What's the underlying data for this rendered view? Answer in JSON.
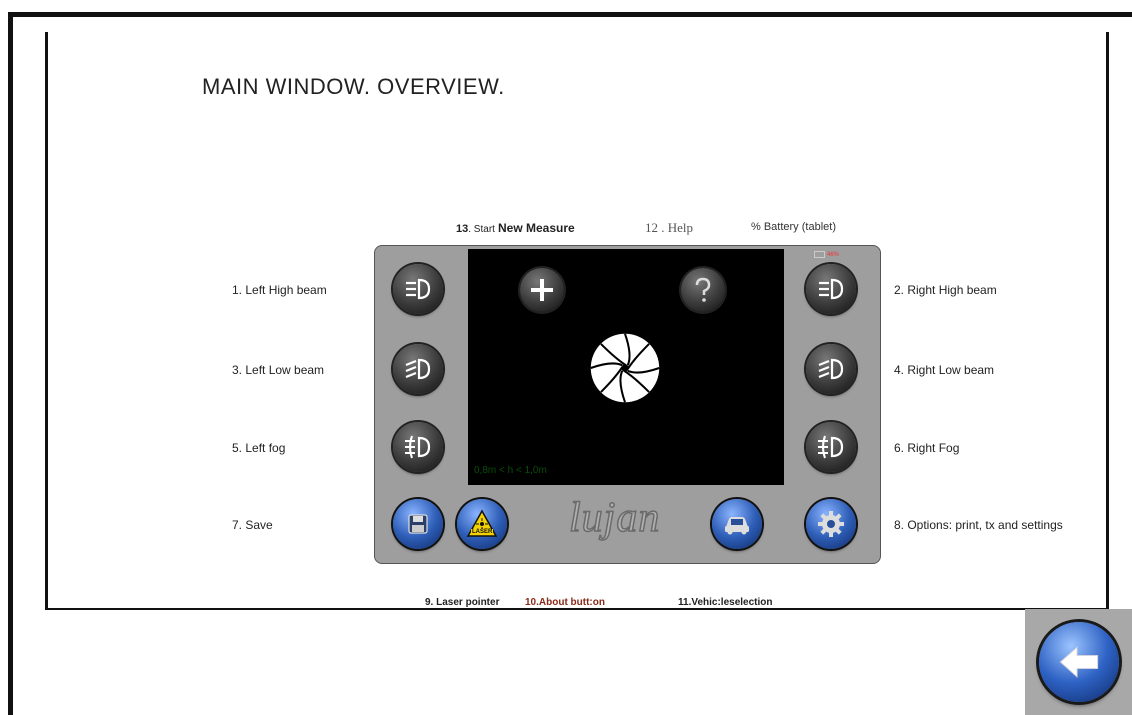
{
  "page": {
    "title": "MAIN WINDOW. OVERVIEW."
  },
  "top_labels": {
    "start_new_measure_num": "13",
    "start_new_measure_small": ". Start",
    "start_new_measure_bold": "New Measure",
    "help": "12 . Help",
    "battery": "% Battery (tablet)"
  },
  "screen": {
    "height_range": "0,8m < h < 1,0m",
    "battery_level": "46%"
  },
  "side_labels": {
    "left_high_beam": "1. Left High beam",
    "right_high_beam": "2. Right High beam",
    "left_low_beam": "3. Left Low beam",
    "right_low_beam": "4. Right Low beam",
    "left_fog": "5. Left fog",
    "right_fog": "6. Right Fog",
    "save": "7. Save",
    "options": "8. Options: print, tx and settings"
  },
  "bottom_labels": {
    "laser_pointer": "9. Laser pointer",
    "about_button": "10.About butt:on",
    "vehicle_selection": "11.Vehic:leselection"
  },
  "logo": {
    "text": "lujan",
    "laser_badge": "LASER"
  },
  "icons": {
    "high_beam": "high-beam-icon",
    "low_beam": "low-beam-icon",
    "fog": "fog-light-icon",
    "plus": "plus-icon",
    "help": "question-icon",
    "aperture": "aperture-icon",
    "save": "floppy-disk-icon",
    "laser": "laser-warning-icon",
    "car": "car-icon",
    "gear": "gear-icon",
    "back": "back-arrow-icon"
  },
  "colors": {
    "screen_bg": "#000000",
    "panel_bg": "#9e9e9e",
    "accent_blue": "#2e62c4",
    "laser_yellow": "#f2d200"
  }
}
